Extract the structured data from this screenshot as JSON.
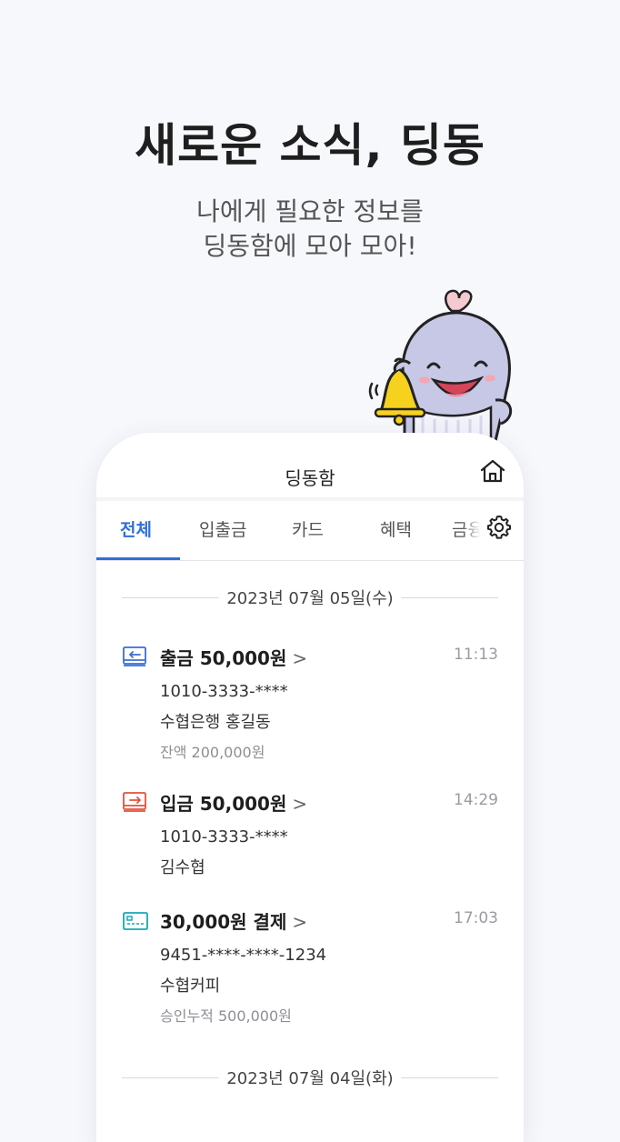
{
  "hero": {
    "headline": "새로운 소식, 딩동",
    "subline_1": "나에게 필요한 정보를",
    "subline_2": "딩동함에 모아 모아!"
  },
  "app": {
    "title": "딩동함",
    "home_icon": "home-icon",
    "settings_icon": "gear-icon",
    "accent_color": "#2f6fd8"
  },
  "tabs": [
    {
      "label": "전체",
      "active": true
    },
    {
      "label": "입출금"
    },
    {
      "label": "카드"
    },
    {
      "label": "혜택"
    },
    {
      "label": "금융"
    }
  ],
  "dates": [
    "2023년 07월 05일(수)",
    "2023년 07월 04일(화)"
  ],
  "notifications": [
    {
      "icon": "withdraw-icon",
      "title": "출금 50,000원",
      "chevron": ">",
      "time": "11:13",
      "line1": "1010-3333-****",
      "line2": "수협은행 홍길동",
      "line3": "잔액 200,000원"
    },
    {
      "icon": "deposit-icon",
      "title": "입금 50,000원",
      "chevron": ">",
      "time": "14:29",
      "line1": "1010-3333-****",
      "line2": "김수협"
    },
    {
      "icon": "card-icon",
      "title": "30,000원 결제",
      "chevron": ">",
      "time": "17:03",
      "line1": "9451-****-****-1234",
      "line2": "수협커피",
      "line3": "승인누적 500,000원"
    }
  ]
}
